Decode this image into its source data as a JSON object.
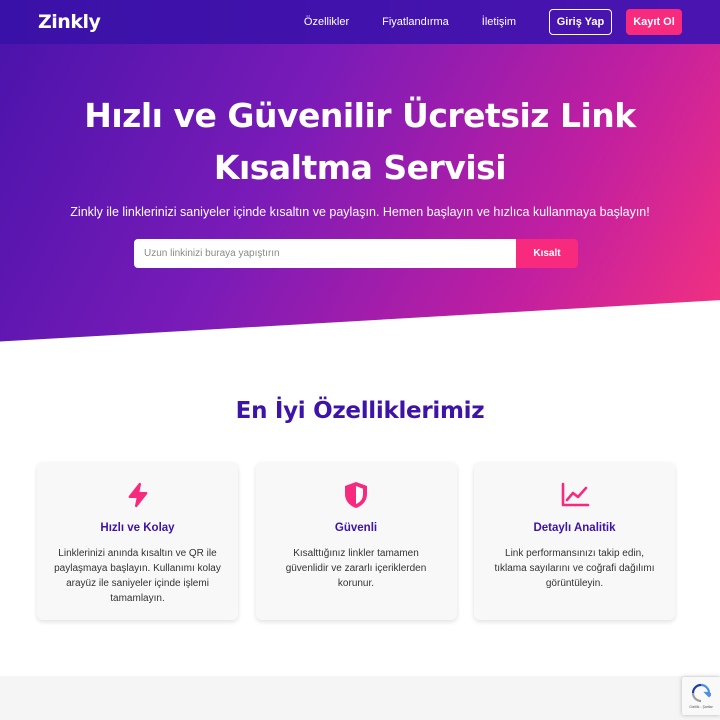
{
  "header": {
    "logo": "Zinkly",
    "nav": [
      "Özellikler",
      "Fiyatlandırma",
      "İletişim"
    ],
    "login_label": "Giriş Yap",
    "register_label": "Kayıt Ol"
  },
  "hero": {
    "title_line1": "Hızlı ve Güvenilir Ücretsiz Link",
    "title_line2": "Kısaltma Servisi",
    "subtitle": "Zinkly ile linklerinizi saniyeler içinde kısaltın ve paylaşın. Hemen başlayın ve hızlıca kullanmaya başlayın!",
    "input_placeholder": "Uzun linkinizi buraya yapıştırın",
    "shorten_label": "Kısalt"
  },
  "features": {
    "title": "En İyi Özelliklerimiz",
    "items": [
      {
        "icon": "lightning-icon",
        "title": "Hızlı ve Kolay",
        "description": "Linklerinizi anında kısaltın ve QR ile paylaşmaya başlayın. Kullanımı kolay arayüz ile saniyeler içinde işlemi tamamlayın."
      },
      {
        "icon": "shield-icon",
        "title": "Güvenli",
        "description": "Kısalttığınız linkler tamamen güvenlidir ve zararlı içeriklerden korunur."
      },
      {
        "icon": "chart-line-icon",
        "title": "Detaylı Analitik",
        "description": "Link performansınızı takip edin, tıklama sayılarını ve coğrafi dağılımı görüntüleyin."
      }
    ]
  },
  "recaptcha": {
    "text": "Gizlilik - Şartlar"
  },
  "colors": {
    "primary": "#3d13a8",
    "accent": "#f72a7e",
    "nav_bg": "#3a11a8"
  }
}
